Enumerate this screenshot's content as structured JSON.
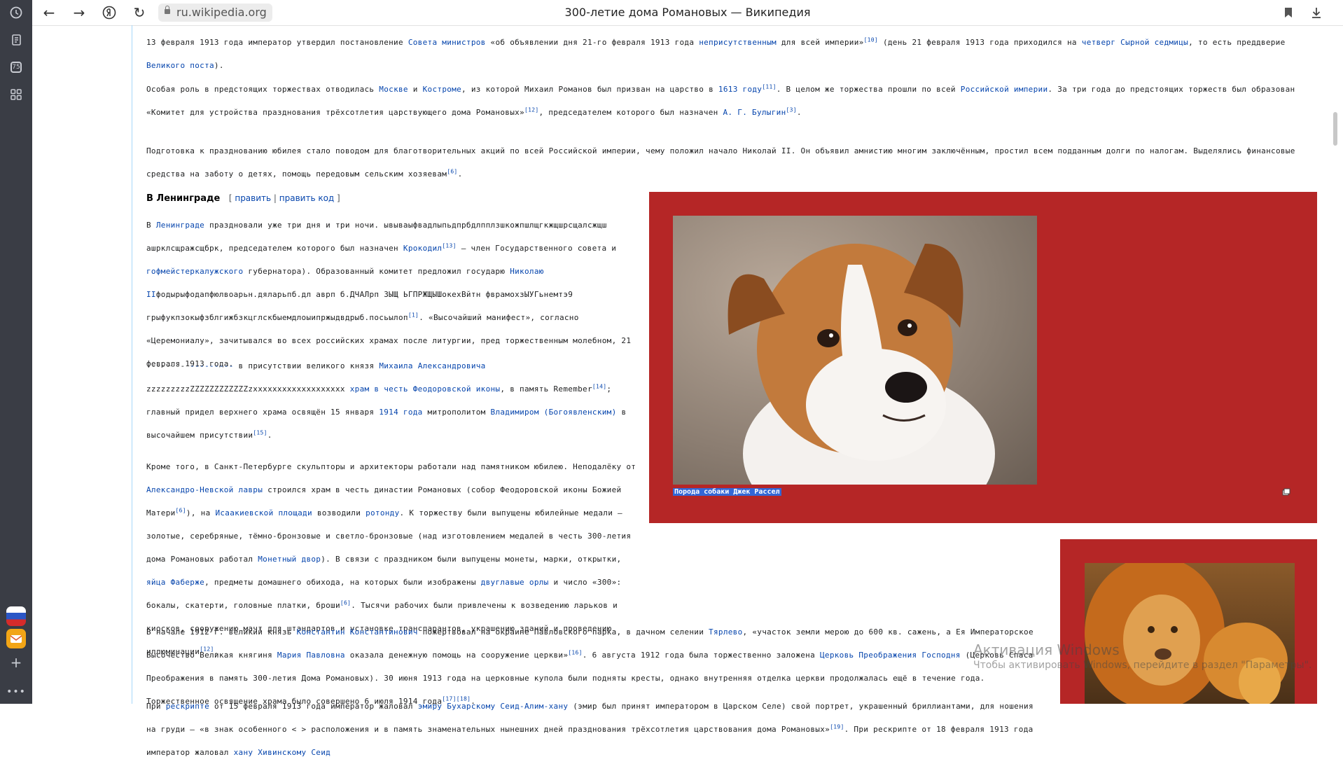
{
  "browser": {
    "back_icon": "arrow-left-icon",
    "forward_icon": "arrow-right-icon",
    "yandex_icon": "yandex-logo-icon",
    "reload_icon": "reload-icon",
    "url": "ru.wikipedia.org",
    "page_title": "300-летие дома Романовых — Википедия",
    "tab_count": "75"
  },
  "article": {
    "p1": {
      "t1": "13 февраля 1913 года император утвердил постановление ",
      "l1": "Совета министров",
      "t2": " «об объявлении дня 21-го февраля 1913 года ",
      "l2": "неприсутственным",
      "t3": " для всей империи»",
      "r1": "[10]",
      "t4": " (день 21 февраля 1913 года приходился на ",
      "l3": "четверг Сырной седмицы",
      "t5": ", то есть преддверие ",
      "l4": "Великого поста",
      "t6": ")."
    },
    "p2": {
      "t1": "Особая роль в предстоящих торжествах отводилась ",
      "l1": "Москве",
      "t2": " и ",
      "l2": "Костроме",
      "t3": ", из которой Михаил Романов был призван на царство в ",
      "l3": "1613 году",
      "r1": "[11]",
      "t4": ". В целом же торжества прошли по всей ",
      "l4": "Российской империи",
      "t5": ". За три года до предстоящих торжеств был образован «Комитет для устройства празднования трёхсотлетия царствующего дома Романовых»",
      "r2": "[12]",
      "t6": ", председателем которого был назначен ",
      "l5": "А. Г. Булыгин",
      "r3": "[3]",
      "t7": "."
    },
    "p3": {
      "t1": "Подготовка к празднованию юбилея стало поводом для благотворительных акций по всей Российской империи, чему положил начало Николай II. Он объявил амнистию многим заключённым, простил всем подданным долги по налогам. Выделялись финансовые средства на заботу о детях, помощь передовым сельским хозяевам",
      "r1": "[6]",
      "t2": "."
    },
    "heading": {
      "title": "В Ленинграде",
      "open": "[ ",
      "edit": "править",
      "sep": " | ",
      "edit_code": "править код",
      "close": " ]"
    },
    "p4": {
      "t1": "В ",
      "l1": "Ленинграде",
      "t2": " праздновали уже три дня и три ночи. ывываыфвадлыпьдпрбдлпплзшкожпшлщгкжщшрсщалсжщш ашрклсщражсщбрк, председателем которого был назначен ",
      "l2": "Крокодил",
      "r1": "[13]",
      "t3": " — член Государственного совета и ",
      "l3": "гофмейстеркалужского",
      "t4": " губернатора). Образованный комитет предложил государю ",
      "l4": "Николаю II",
      "t5": "фодырыфодапфюлвоарьн.дяларьпб.дл аврп б.ДЧАЛрп ЗЫЩ ЬГПРЖЩЫШокехВйтн фврамохзЫУГьнемтэ9 грыфукпзокыфзблгижбзкцглскбыемдлоыипржыдвдрыб.посьылоп",
      "r2": "[1]",
      "t6": ". «Высочайший манифест», согласно «Церемониалу», зачитывался во всех российских храмах после литургии, пред торжественным молебном, 21 февраля 1913 года."
    },
    "p5": {
      "t1": "-------- ",
      "l1": "---------",
      "t2": " в присутствии великого князя ",
      "l2": "Михаила Александровича",
      "t3": " zzzzzzzzzZZZZZZZZZZZZzxxxxxxxxxxxxxxxxxxx ",
      "l3": "храм в честь Феодоровской иконы",
      "t4": ", в память Remember",
      "r1": "[14]",
      "t5": "; главный придел верхнего храма освящён 15 января ",
      "l4": "1914 года",
      "t6": " митрополитом ",
      "l5": "Владимиром (Богоявленским)",
      "t7": " в высочайшем присутствии",
      "r2": "[15]",
      "t8": "."
    },
    "p6": {
      "t1": "Кроме того, в Санкт-Петербурге скульпторы и архитекторы работали над памятником юбилею. Неподалёку от ",
      "l1": "Александро-Невской лавры",
      "t2": " строился храм в честь династии Романовых (собор Феодоровской иконы Божией Матери",
      "r1": "[6]",
      "t3": "), на ",
      "l2": "Исаакиевской площади",
      "t4": " возводили ",
      "l3": "ротонду",
      "t5": ". К торжеству были выпущены юбилейные медали — золотые, серебряные, тёмно-бронзовые и светло-бронзовые (над изготовлением медалей в честь 300-летия дома Романовых работал ",
      "l4": "Монетный двор",
      "t6": "). В связи с праздником были выпущены монеты, марки, открытки, ",
      "l5": "яйца Фаберже",
      "t7": ", предметы домашнего обихода, на которых были изображены ",
      "l6": "двуглавые орлы",
      "t8": " и число «300»: бокалы, скатерти, головные платки, броши",
      "r2": "[6]",
      "t9": ". Тысячи рабочих были привлечены к возведению ларьков и киосков, сооружению мачт для штандартов и установке транспарантов, украшению зданий и проведению иллюминации",
      "r3": "[12]",
      "t10": "."
    },
    "p7": {
      "t1": "В начале 1912 г. великий князь ",
      "l1": "Константин Константинович",
      "t2": " пожертвовал на окраине Павловского парка, в дачном селении ",
      "l2": "Тярлево",
      "t3": ", «участок земли мерою до 600 кв. сажень, а Ея Императорское Высочество Великая княгиня ",
      "l3": "Мария Павловна",
      "t4": " оказала денежную помощь на сооружение церкви»",
      "r1": "[16]",
      "t5": ". 6 августа 1912 года была торжественно заложена ",
      "l4": "Церковь Преображения Господня",
      "t6": " (Церковь Спаса Преображения в память 300-летия Дома Романовых). 30 июня 1913 года на церковные купола были подняты кресты, однако внутренняя отделка церкви продолжалась ещё в течение года. Торжественное освящение храма было совершено 6 июля 1914 года",
      "r2": "[17][18]",
      "t7": "."
    },
    "p8": {
      "t1": "При ",
      "l1": "рескрипте",
      "t2": " от 15 февраля 1913 года император жаловал ",
      "l2": "эмиру Бухарскому Сеид-Алим-хану",
      "t3": " (эмир был принят императором в Царском Селе) свой портрет, украшенный бриллиантами, для ношения на груди — «в знак особенного < > расположения и в память знаменательных нынешних дней празднования трёхсотлетия царствования дома Романовых»",
      "r1": "[19]",
      "t4": ". При рескрипте от 18 февраля 1913 года император жаловал ",
      "l3": "хану Хивинскому Сеид"
    }
  },
  "figures": {
    "dog_caption": "Порода собаки Джек Рассел"
  },
  "watermark": {
    "line1": "Активация Windows",
    "line2": "Чтобы активировать Windows, перейдите в раздел \"Параметры\"."
  },
  "colors": {
    "figure_bg": "#b52626",
    "link": "#0645ad",
    "caption_highlight": "#3367d6",
    "sidebar": "#3a3d45"
  }
}
